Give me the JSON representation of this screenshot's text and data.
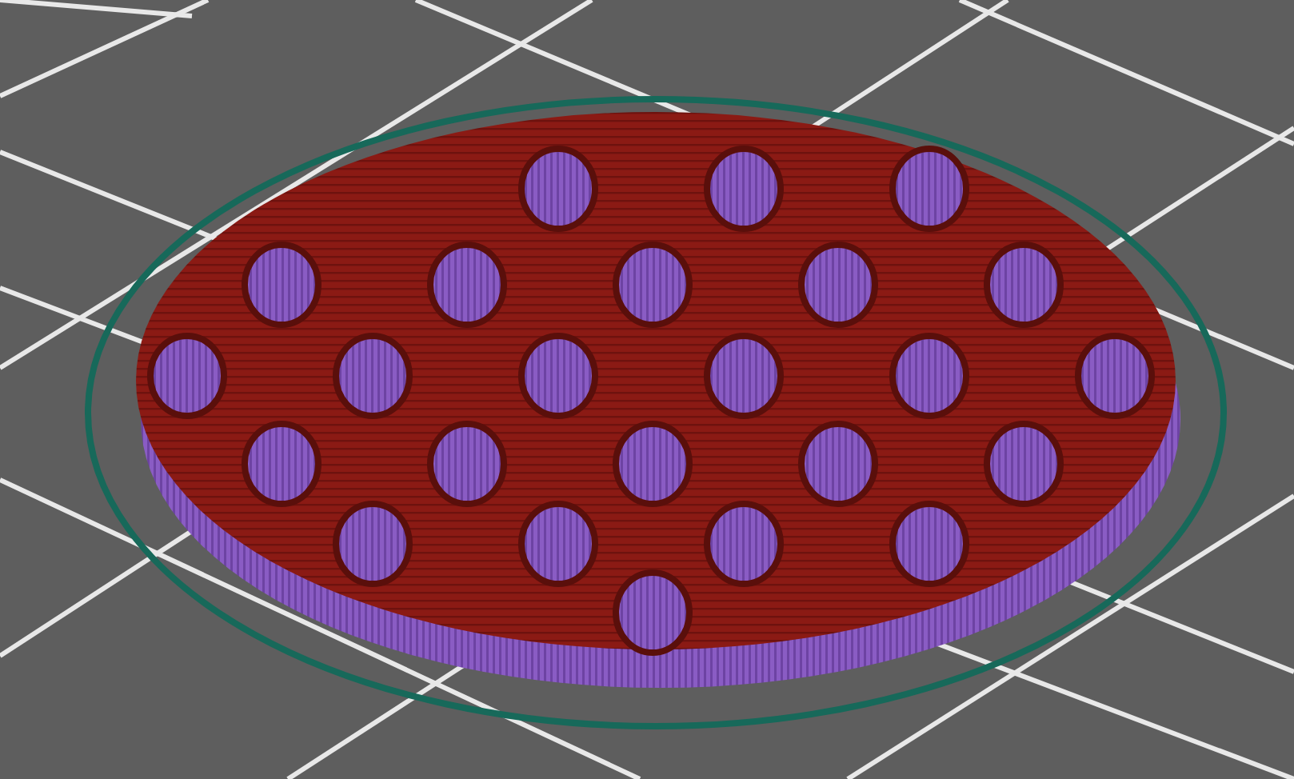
{
  "viewport": {
    "kind": "slice-preview"
  }
}
